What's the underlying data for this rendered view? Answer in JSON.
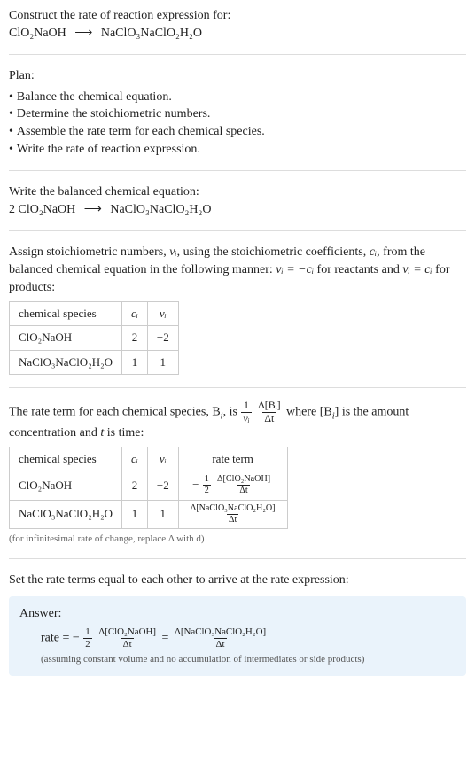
{
  "intro": {
    "prompt": "Construct the rate of reaction expression for:",
    "equation_left": "ClO₂NaOH",
    "arrow": "⟶",
    "equation_right": "NaClO₃NaClO₂H₂O"
  },
  "plan": {
    "title": "Plan:",
    "items": [
      "Balance the chemical equation.",
      "Determine the stoichiometric numbers.",
      "Assemble the rate term for each chemical species.",
      "Write the rate of reaction expression."
    ]
  },
  "balanced": {
    "title": "Write the balanced chemical equation:",
    "equation_left": "2 ClO₂NaOH",
    "arrow": "⟶",
    "equation_right": "NaClO₃NaClO₂H₂O"
  },
  "stoich": {
    "text_a": "Assign stoichiometric numbers, ",
    "nu_i": "νᵢ",
    "text_b": ", using the stoichiometric coefficients, ",
    "c_i": "cᵢ",
    "text_c": ", from the balanced chemical equation in the following manner: ",
    "eq1": "νᵢ = −cᵢ",
    "text_d": " for reactants and ",
    "eq2": "νᵢ = cᵢ",
    "text_e": " for products:",
    "table": {
      "headers": [
        "chemical species",
        "cᵢ",
        "νᵢ"
      ],
      "rows": [
        [
          "ClO₂NaOH",
          "2",
          "−2"
        ],
        [
          "NaClO₃NaClO₂H₂O",
          "1",
          "1"
        ]
      ]
    }
  },
  "rate_term": {
    "text_a": "The rate term for each chemical species, B",
    "sub_i": "i",
    "text_b": ", is ",
    "frac1_num": "1",
    "frac1_den": "νᵢ",
    "frac2_num": "Δ[Bᵢ]",
    "frac2_den": "Δt",
    "text_c": " where [B",
    "text_d": "] is the amount concentration and ",
    "t": "t",
    "text_e": " is time:",
    "table": {
      "headers": [
        "chemical species",
        "cᵢ",
        "νᵢ",
        "rate term"
      ],
      "rows": [
        {
          "species": "ClO₂NaOH",
          "c": "2",
          "nu": "−2",
          "neg": "−",
          "f1n": "1",
          "f1d": "2",
          "f2n": "Δ[ClO₂NaOH]",
          "f2d": "Δt"
        },
        {
          "species": "NaClO₃NaClO₂H₂O",
          "c": "1",
          "nu": "1",
          "neg": "",
          "f1n": "",
          "f1d": "",
          "f2n": "Δ[NaClO₃NaClO₂H₂O]",
          "f2d": "Δt"
        }
      ]
    },
    "note": "(for infinitesimal rate of change, replace Δ with d)"
  },
  "final": {
    "title": "Set the rate terms equal to each other to arrive at the rate expression:",
    "answer_label": "Answer:",
    "rate_eq_prefix": "rate = −",
    "f1n": "1",
    "f1d": "2",
    "f2n": "Δ[ClO₂NaOH]",
    "f2d": "Δt",
    "equals": " = ",
    "f3n": "Δ[NaClO₃NaClO₂H₂O]",
    "f3d": "Δt",
    "note": "(assuming constant volume and no accumulation of intermediates or side products)"
  }
}
